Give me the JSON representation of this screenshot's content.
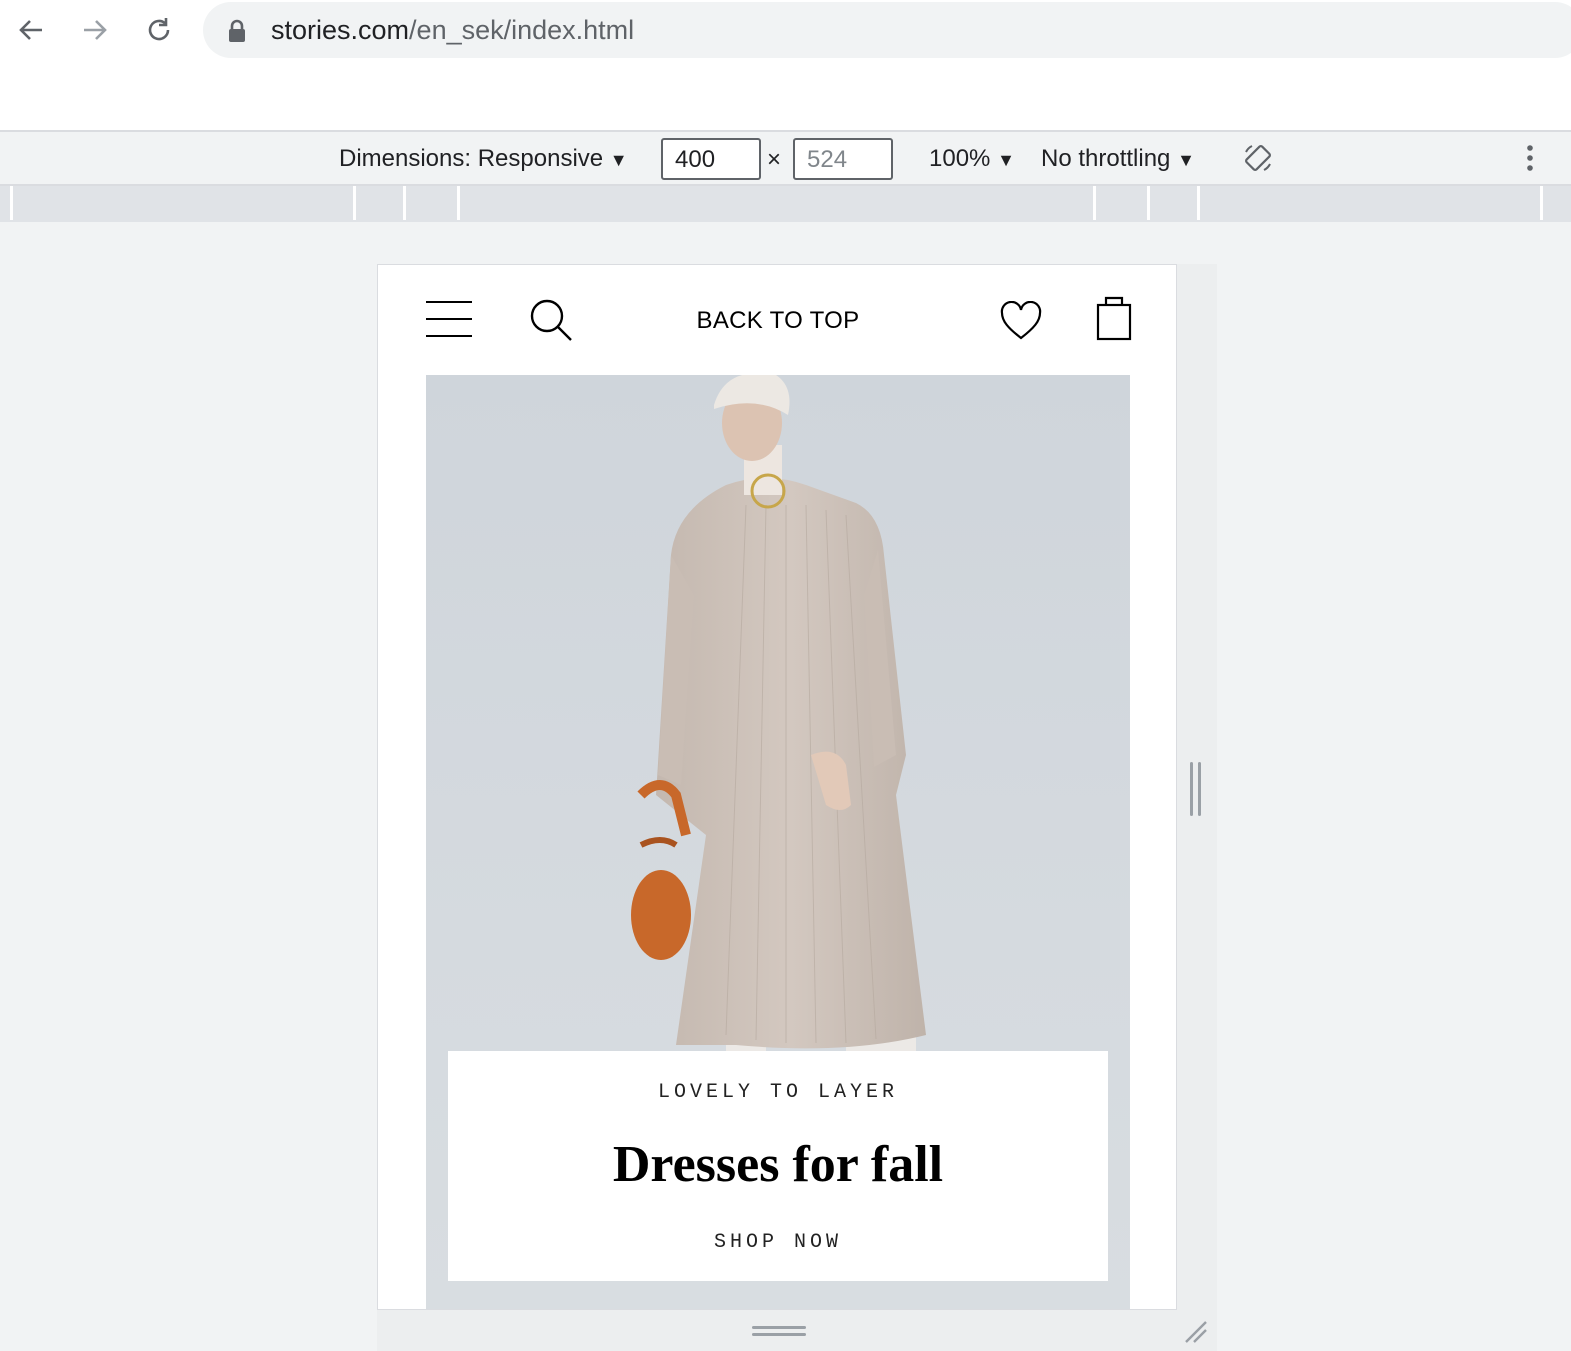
{
  "browser": {
    "url_domain": "stories.com",
    "url_path": "/en_sek/index.html"
  },
  "devtools": {
    "dimensions_label": "Dimensions: Responsive",
    "width_value": "400",
    "height_placeholder": "524",
    "times": "×",
    "zoom": "100%",
    "throttling": "No throttling"
  },
  "site": {
    "header": {
      "back_to_top": "BACK TO TOP"
    },
    "promo": {
      "kicker": "LOVELY TO LAYER",
      "title": "Dresses for fall",
      "cta": "SHOP NOW"
    }
  },
  "colors": {
    "accent_bag": "#c8682a",
    "dress": "#cdc2ba",
    "hero_bg": "#d3d8dd"
  }
}
